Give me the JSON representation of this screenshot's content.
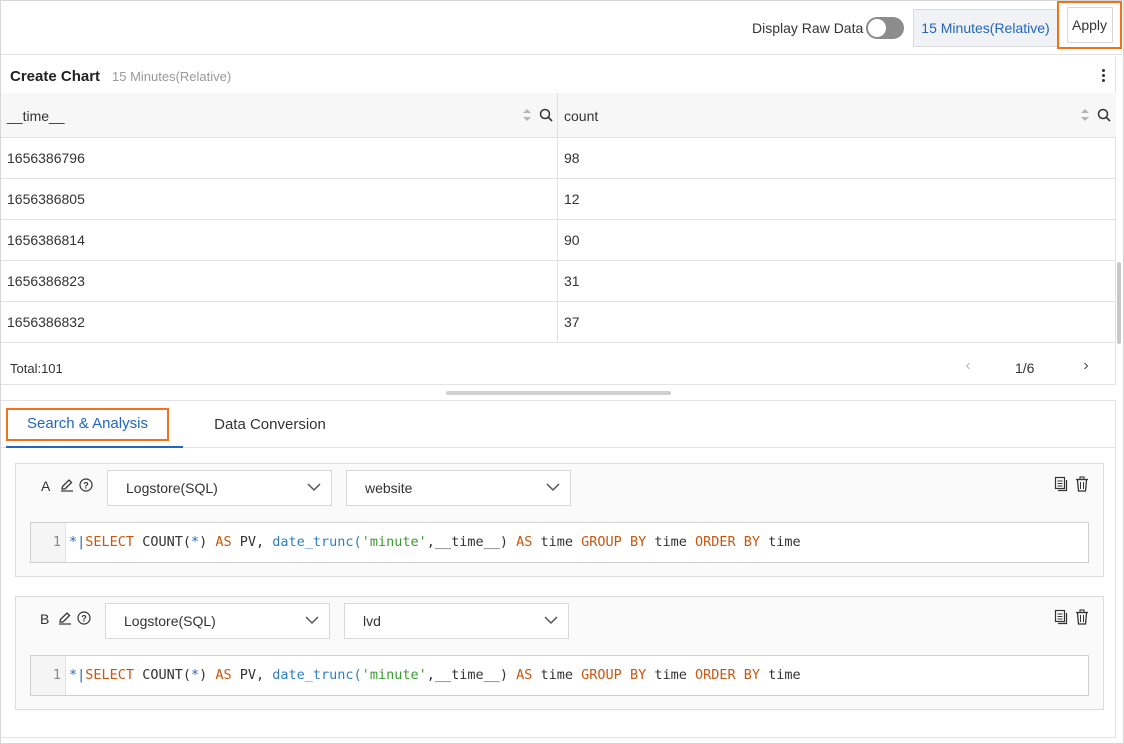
{
  "topbar": {
    "display_raw_label": "Display Raw Data",
    "time_range": "15 Minutes(Relative)",
    "apply_label": "Apply"
  },
  "chart": {
    "title": "Create Chart",
    "subtitle": "15 Minutes(Relative)",
    "columns": [
      "__time__",
      "count"
    ],
    "rows": [
      [
        "1656386796",
        "98"
      ],
      [
        "1656386805",
        "12"
      ],
      [
        "1656386814",
        "90"
      ],
      [
        "1656386823",
        "31"
      ],
      [
        "1656386832",
        "37"
      ]
    ],
    "total": "Total:101",
    "page": "1/6",
    "prev_glyph": "‹",
    "next_glyph": "›"
  },
  "tabs": {
    "search": "Search & Analysis",
    "conversion": "Data Conversion"
  },
  "queries": [
    {
      "letter": "A",
      "source_type": "Logstore(SQL)",
      "logstore": "website",
      "line_number": "1",
      "code": {
        "star": "*",
        "cursor": "|",
        "t1": "SELECT",
        "t2": " COUNT(",
        "t3": "*",
        "t4": ") ",
        "t5": "AS",
        "t6": " PV, ",
        "t7": "date_trunc(",
        "t8": "'minute'",
        "t9": ",__time__) ",
        "t10": "AS",
        "t11": " time ",
        "t12": "GROUP BY",
        "t13": " time ",
        "t14": "ORDER BY",
        "t15": " time"
      }
    },
    {
      "letter": "B",
      "source_type": "Logstore(SQL)",
      "logstore": "lvd",
      "line_number": "1",
      "code": {
        "star": "*",
        "cursor": "|",
        "t1": "SELECT",
        "t2": " COUNT(",
        "t3": "*",
        "t4": ") ",
        "t5": "AS",
        "t6": " PV, ",
        "t7": "date_trunc(",
        "t8": "'minute'",
        "t9": ",__time__) ",
        "t10": "AS",
        "t11": " time ",
        "t12": "GROUP BY",
        "t13": " time ",
        "t14": "ORDER BY",
        "t15": " time"
      }
    }
  ],
  "colors": {
    "accent": "#2266c2",
    "highlight": "#f0731a",
    "keyword": "#c8570f",
    "string": "#3a9c2e"
  },
  "icons": [
    "more-vertical-icon",
    "sort-icon",
    "search-icon",
    "edit-icon",
    "help-icon",
    "chevron-down-icon",
    "copy-icon",
    "trash-icon"
  ]
}
